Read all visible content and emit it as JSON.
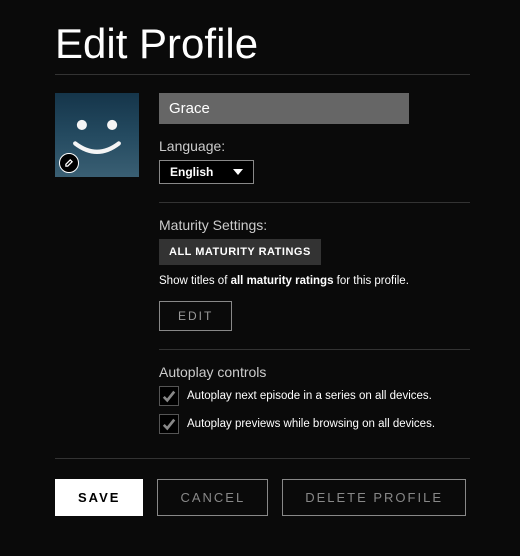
{
  "title": "Edit Profile",
  "profile": {
    "name": "Grace"
  },
  "language": {
    "label": "Language:",
    "selected": "English"
  },
  "maturity": {
    "label": "Maturity Settings:",
    "chip": "ALL MATURITY RATINGS",
    "desc_prefix": "Show titles of ",
    "desc_bold": "all maturity ratings",
    "desc_suffix": " for this profile.",
    "edit_btn": "EDIT"
  },
  "autoplay": {
    "label": "Autoplay controls",
    "items": [
      {
        "text": "Autoplay next episode in a series on all devices.",
        "checked": true
      },
      {
        "text": "Autoplay previews while browsing on all devices.",
        "checked": true
      }
    ]
  },
  "actions": {
    "save": "SAVE",
    "cancel": "CANCEL",
    "delete": "DELETE PROFILE"
  }
}
